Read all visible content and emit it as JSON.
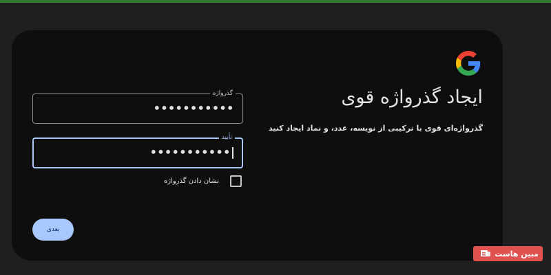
{
  "header": {
    "title": "ایجاد گذرواژه قوی",
    "subtitle": "گذرواژه‌ای قوی با ترکیبی از نویسه، عدد، و نماد ایجاد کنید"
  },
  "password_field": {
    "label": "گذرواژه",
    "value": "•••••••••••"
  },
  "confirm_field": {
    "label": "تأیید",
    "value": "•••••••••••"
  },
  "show_password": {
    "label": "نشان دادن گذرواژه",
    "checked": false
  },
  "actions": {
    "next_label": "بعدی"
  },
  "watermark": {
    "text": "مبین هاست"
  },
  "colors": {
    "accent": "#a8c7fa",
    "background": "#1f1f1f",
    "card": "#0e0e0f",
    "watermark": "#e0524f"
  }
}
